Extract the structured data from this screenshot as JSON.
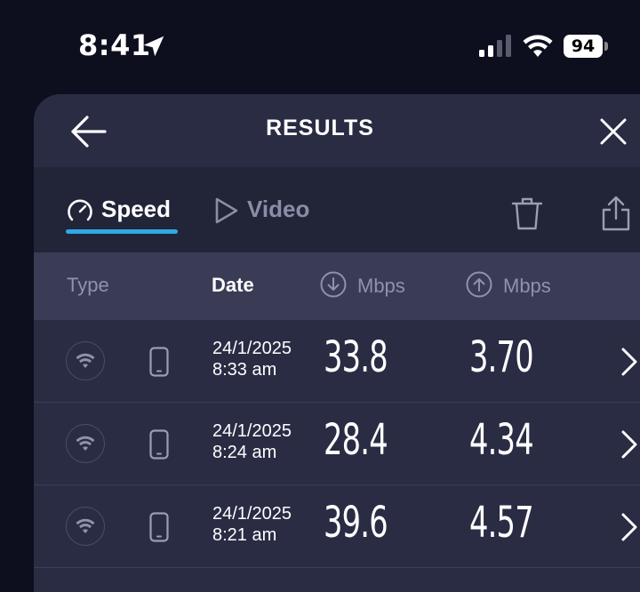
{
  "status_bar": {
    "time": "8:41",
    "battery": "94"
  },
  "header": {
    "title": "RESULTS"
  },
  "tabs": [
    {
      "label": "Speed",
      "active": true
    },
    {
      "label": "Video",
      "active": false
    }
  ],
  "columns": {
    "type": "Type",
    "date": "Date",
    "download": "Mbps",
    "upload": "Mbps"
  },
  "rows": [
    {
      "connection": "wifi-icon",
      "device": "phone-icon",
      "date": "24/1/2025",
      "time": "8:33 am",
      "download": "33.8",
      "upload": "3.70"
    },
    {
      "connection": "wifi-icon",
      "device": "phone-icon",
      "date": "24/1/2025",
      "time": "8:24 am",
      "download": "28.4",
      "upload": "4.34"
    },
    {
      "connection": "wifi-icon",
      "device": "phone-icon",
      "date": "24/1/2025",
      "time": "8:21 am",
      "download": "39.6",
      "upload": "4.57"
    }
  ],
  "colors": {
    "background": "#0d0f1f",
    "card": "#2a2c44",
    "tab_bar": "#222438",
    "column_header": "#3a3c56",
    "accent": "#2fa8e8"
  }
}
